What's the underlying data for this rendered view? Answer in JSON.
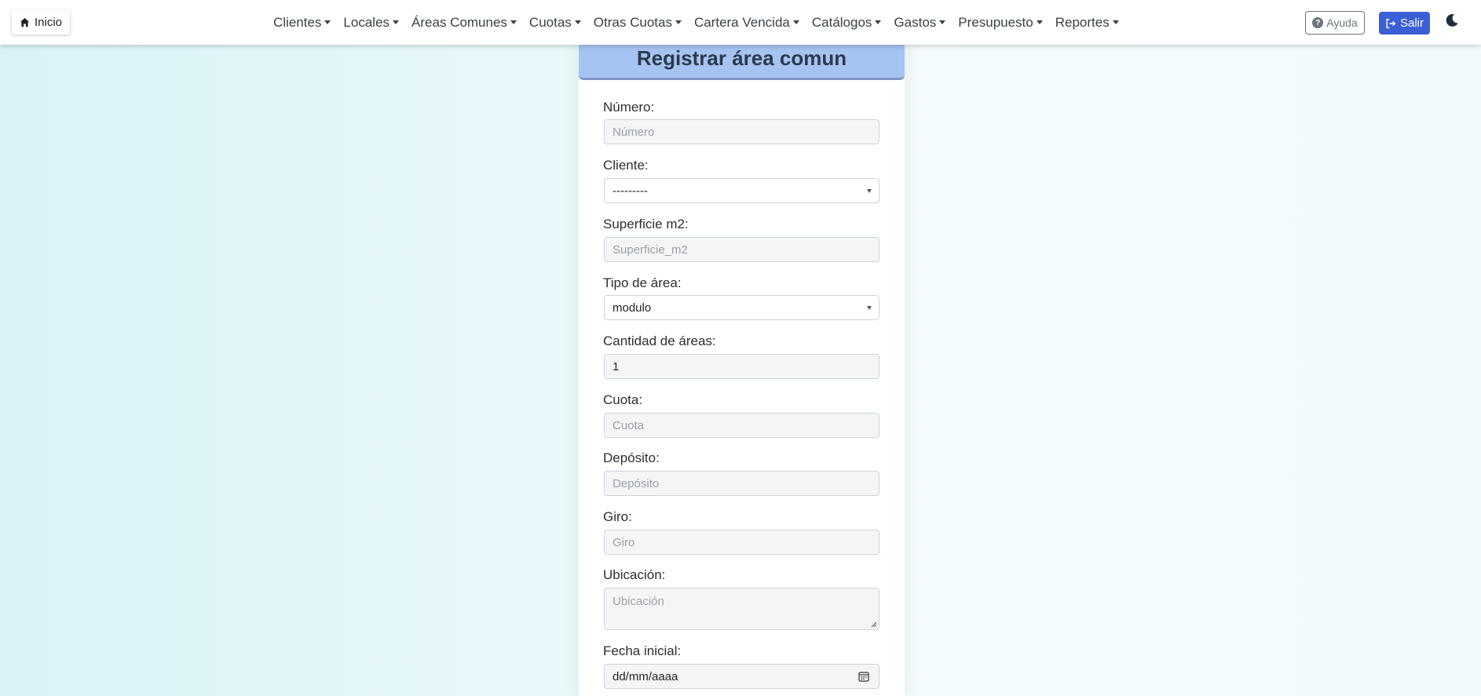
{
  "navbar": {
    "home_label": "Inicio",
    "menu": [
      "Clientes",
      "Locales",
      "Áreas Comunes",
      "Cuotas",
      "Otras Cuotas",
      "Cartera Vencida",
      "Catálogos",
      "Gastos",
      "Presupuesto",
      "Reportes"
    ],
    "help_label": "Ayuda",
    "exit_label": "Salir"
  },
  "form": {
    "title": "Registrar área comun",
    "numero": {
      "label": "Número:",
      "placeholder": "Número"
    },
    "cliente": {
      "label": "Cliente:",
      "value": "---------"
    },
    "superficie": {
      "label": "Superficie m2:",
      "placeholder": "Superficie_m2"
    },
    "tipo_area": {
      "label": "Tipo de área:",
      "value": "modulo"
    },
    "cantidad": {
      "label": "Cantidad de áreas:",
      "value": "1"
    },
    "cuota": {
      "label": "Cuota:",
      "placeholder": "Cuota"
    },
    "deposito": {
      "label": "Depósito:",
      "placeholder": "Depósito"
    },
    "giro": {
      "label": "Giro:",
      "placeholder": "Giro"
    },
    "ubicacion": {
      "label": "Ubicación:",
      "placeholder": "Ubicación"
    },
    "fecha_inicial": {
      "label": "Fecha inicial:",
      "value": "dd/mm/aaaa"
    }
  },
  "colors": {
    "header_bg": "#a5c4f2",
    "exit_button": "#3b5fd6",
    "navbar_bg": "#ffffff"
  }
}
